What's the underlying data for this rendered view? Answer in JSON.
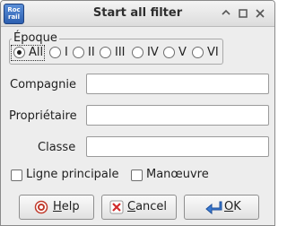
{
  "window": {
    "title": "Start all filter",
    "app_icon_text": "Roc rail"
  },
  "epoque": {
    "label": "Époque",
    "options": [
      "All",
      "I",
      "II",
      "III",
      "IV",
      "V",
      "VI"
    ],
    "selected": "All"
  },
  "fields": {
    "compagnie": {
      "label": "Compagnie",
      "value": ""
    },
    "proprietaire": {
      "label": "Propriétaire",
      "value": ""
    },
    "classe": {
      "label": "Classe",
      "value": ""
    }
  },
  "checks": {
    "ligne_principale": {
      "label": "Ligne principale",
      "checked": false
    },
    "manoeuvre": {
      "label": "Manœuvre",
      "checked": false
    }
  },
  "buttons": {
    "help_u": "H",
    "help_rest": "elp",
    "cancel_u": "C",
    "cancel_rest": "ancel",
    "ok_u": "O",
    "ok_rest": "K"
  },
  "colors": {
    "ok_arrow": "#3a7bd5",
    "help_icon": "#c0392b",
    "cancel_icon": "#d12b2b"
  },
  "icons": [
    "minimize-icon",
    "maximize-icon",
    "close-icon",
    "help-icon",
    "cancel-icon",
    "ok-arrow-icon"
  ]
}
